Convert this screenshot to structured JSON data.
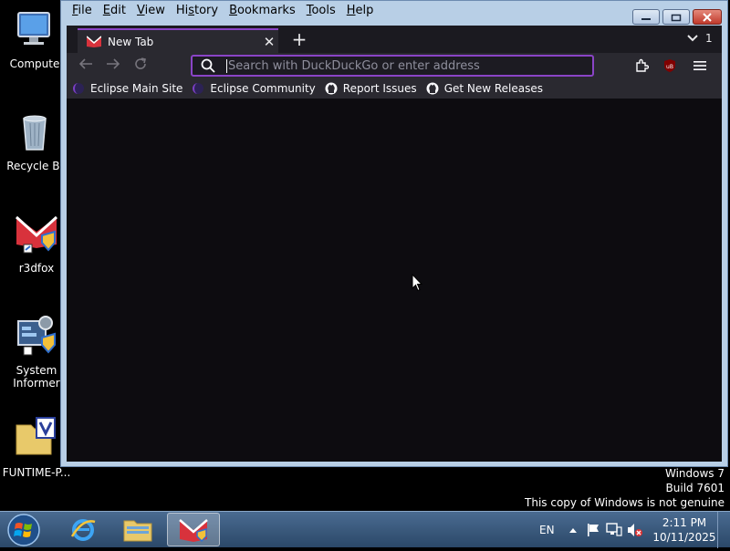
{
  "desktop": {
    "icons": [
      {
        "label": "Compute"
      },
      {
        "label": "Recycle Bi"
      },
      {
        "label": "r3dfox"
      },
      {
        "label": "System\nInformer"
      },
      {
        "label": "FUNTIME-P..."
      }
    ]
  },
  "window": {
    "menu": [
      "File",
      "Edit",
      "View",
      "History",
      "Bookmarks",
      "Tools",
      "Help"
    ],
    "menu_access_keys": [
      "F",
      "E",
      "V",
      "s",
      "B",
      "T",
      "H"
    ]
  },
  "tab": {
    "title": "New Tab",
    "list_count": "1"
  },
  "urlbar": {
    "placeholder": "Search with DuckDuckGo or enter address",
    "value": ""
  },
  "bookmarks": [
    {
      "label": "Eclipse Main Site",
      "icon": "eclipse-icon"
    },
    {
      "label": "Eclipse Community",
      "icon": "eclipse-icon"
    },
    {
      "label": "Report Issues",
      "icon": "github-icon"
    },
    {
      "label": "Get New Releases",
      "icon": "github-icon"
    }
  ],
  "watermark": {
    "line1": "Windows 7",
    "line2": "Build 7601",
    "line3": "This copy of Windows is not genuine"
  },
  "taskbar": {
    "language": "EN",
    "time": "2:11 PM",
    "date": "10/11/2025"
  },
  "colors": {
    "accent": "#8a44c6",
    "content_bg": "#0d0c10",
    "toolbar_bg": "#2a2930"
  }
}
